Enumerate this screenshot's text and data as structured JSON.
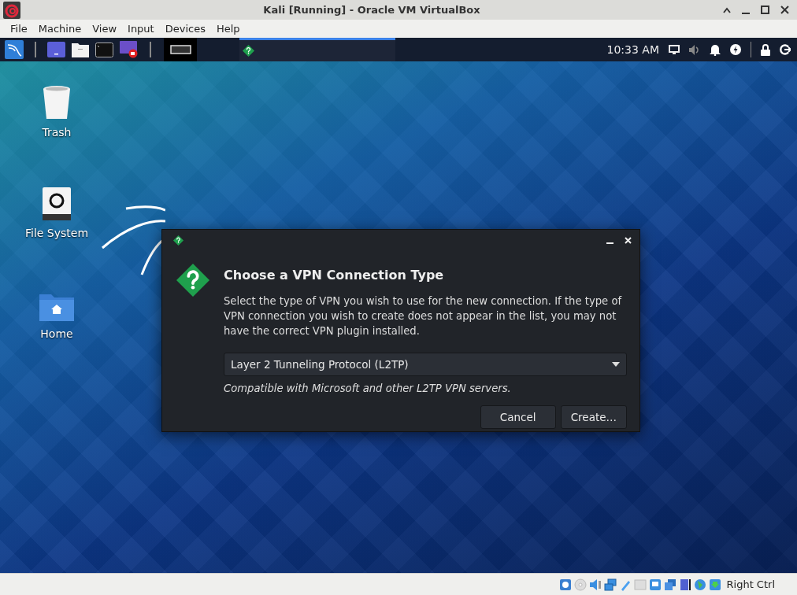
{
  "window": {
    "title": "Kali [Running] - Oracle VM VirtualBox"
  },
  "menu": [
    "File",
    "Machine",
    "View",
    "Input",
    "Devices",
    "Help"
  ],
  "taskbar": [
    {
      "selected": true
    }
  ],
  "clock": "10:33 AM",
  "desktop_icons": [
    {
      "label": "Trash",
      "kind": "trash"
    },
    {
      "label": "File System",
      "kind": "drive"
    },
    {
      "label": "Home",
      "kind": "home"
    }
  ],
  "dialog": {
    "title": "Choose a VPN Connection Type",
    "message": "Select the type of VPN you wish to use for the new connection. If the type of VPN connection you wish to create does not appear in the list, you may not have the correct VPN plugin installed.",
    "dropdown": {
      "value": "Layer 2 Tunneling Protocol (L2TP)"
    },
    "hint": "Compatible with Microsoft and other L2TP VPN servers.",
    "buttons": [
      "Cancel",
      "Create…"
    ]
  },
  "status_bar": {
    "host_key": "Right Ctrl"
  }
}
